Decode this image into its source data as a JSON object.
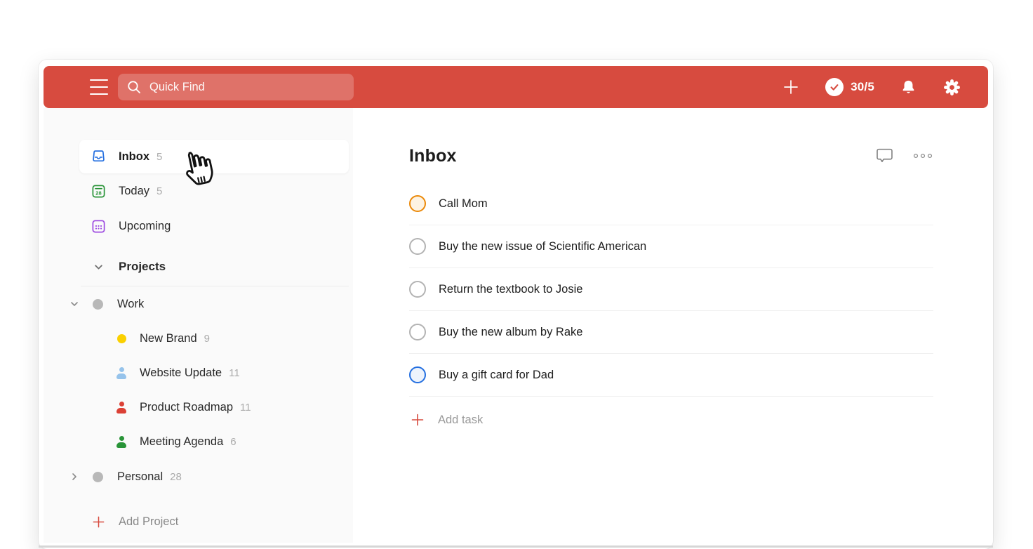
{
  "colors": {
    "header_red": "#d74b3f",
    "sidebar_bg": "#fafafa",
    "inbox_blue": "#246fe0",
    "today_green": "#299438",
    "upcoming_purple": "#9d4ae0",
    "project_grey": "#b8b8b8",
    "task_orange": "#eb8909",
    "task_blue": "#246fe0"
  },
  "header": {
    "menu_icon": "hamburger-menu-icon",
    "search": {
      "placeholder": "Quick Find",
      "icon": "search-icon"
    },
    "add_icon": "plus-icon",
    "karma": {
      "value": "30/5",
      "icon": "checkmark-circle-icon"
    },
    "bell_icon": "notifications-bell-icon",
    "gear_icon": "settings-gear-icon"
  },
  "sidebar": {
    "inbox": {
      "label": "Inbox",
      "count": "5"
    },
    "today": {
      "label": "Today",
      "count": "5",
      "icon_day": "28"
    },
    "upcoming": {
      "label": "Upcoming"
    },
    "projects_header": {
      "label": "Projects"
    },
    "work": {
      "label": "Work",
      "color_style": "color:#b8b8b8"
    },
    "work_children": [
      {
        "label": "New Brand",
        "count": "9",
        "icon": "color-dot",
        "color_style": "color:#fad000"
      },
      {
        "label": "Website Update",
        "count": "11",
        "icon": "person-icon",
        "color_style": "color:#96c3eb"
      },
      {
        "label": "Product Roadmap",
        "count": "11",
        "icon": "person-icon",
        "color_style": "color:#db4035"
      },
      {
        "label": "Meeting Agenda",
        "count": "6",
        "icon": "person-icon",
        "color_style": "color:#299438"
      }
    ],
    "personal": {
      "label": "Personal",
      "count": "28",
      "color_style": "color:#b8b8b8"
    },
    "add_project": {
      "label": "Add Project"
    }
  },
  "main": {
    "title": "Inbox",
    "comment_icon": "comment-icon",
    "more_icon": "more-options-icon",
    "tasks": [
      {
        "label": "Call Mom",
        "circle_style": "border-color:#eb8909;background:#fdf3e3"
      },
      {
        "label": "Buy the new issue of Scientific American",
        "circle_style": "border-color:#b3b3b3;background:#ffffff"
      },
      {
        "label": "Return the textbook to Josie",
        "circle_style": "border-color:#b3b3b3;background:#ffffff"
      },
      {
        "label": "Buy the new album by Rake",
        "circle_style": "border-color:#b3b3b3;background:#ffffff"
      },
      {
        "label": "Buy a gift card for Dad",
        "circle_style": "border-color:#246fe0;background:#edf3fc"
      }
    ],
    "add_task": {
      "label": "Add task"
    }
  },
  "cursor": {
    "type": "pointing-hand"
  }
}
